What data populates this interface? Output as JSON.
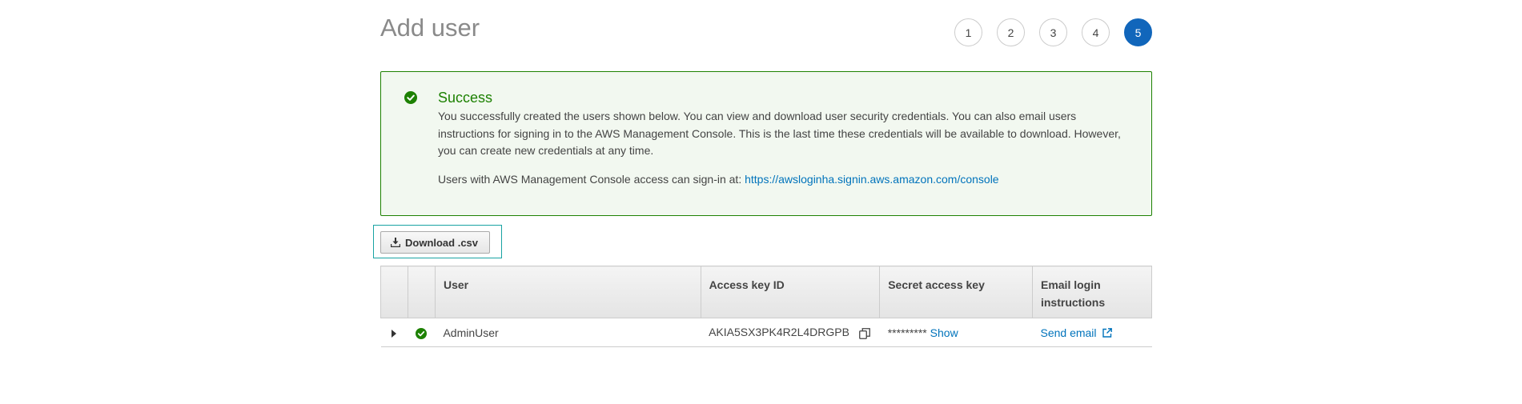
{
  "header": {
    "title": "Add user",
    "steps": [
      "1",
      "2",
      "3",
      "4",
      "5"
    ],
    "active_step": "5"
  },
  "success": {
    "title": "Success",
    "message": "You successfully created the users shown below. You can view and download user security credentials. You can also email users instructions for signing in to the AWS Management Console. This is the last time these credentials will be available to download. However, you can create new credentials at any time.",
    "signin_prefix": "Users with AWS Management Console access can sign-in at: ",
    "signin_url": "https://awsloginha.signin.aws.amazon.com/console"
  },
  "toolbar": {
    "download_label": "Download .csv"
  },
  "table": {
    "columns": {
      "user": "User",
      "access_key": "Access key ID",
      "secret_key": "Secret access key",
      "email": "Email login instructions"
    },
    "rows": [
      {
        "user": "AdminUser",
        "access_key": "AKIA5SX3PK4R2L4DRGPB",
        "secret_mask": "*********",
        "show_label": "Show",
        "email_label": "Send email"
      }
    ]
  },
  "colors": {
    "accent": "#1166bb",
    "success": "#1d8102",
    "success_bg": "#f2f8f0",
    "link": "#0073bb",
    "focus": "#19a3a3"
  },
  "icons": {
    "success": "check-circle-icon",
    "download": "download-icon",
    "expand": "caret-right-icon",
    "copy": "copy-icon",
    "external": "external-link-icon"
  }
}
